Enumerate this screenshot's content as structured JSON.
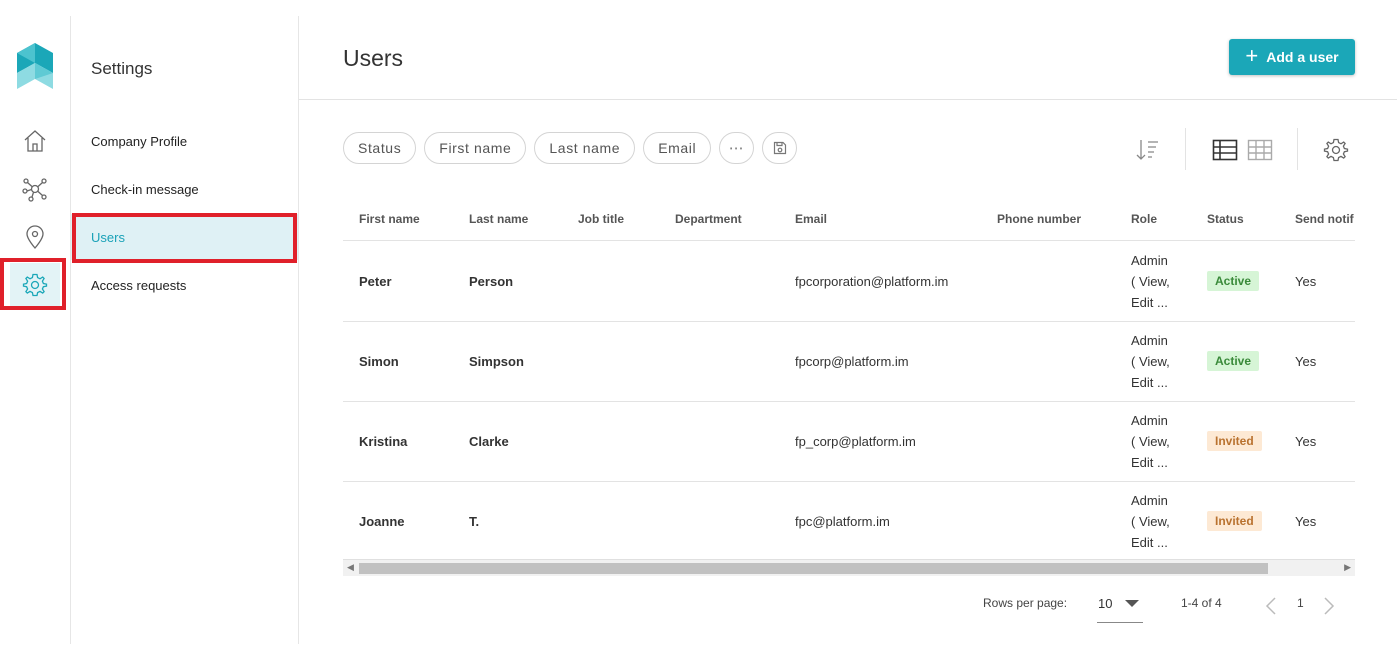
{
  "brand": {
    "accent": "#1ba7b8",
    "highlight": "#e0202a"
  },
  "rail": {
    "items": [
      {
        "icon": "home-icon"
      },
      {
        "icon": "network-icon"
      },
      {
        "icon": "location-pin-icon"
      },
      {
        "icon": "gear-icon",
        "active": true
      }
    ]
  },
  "settings_nav": {
    "title": "Settings",
    "items": [
      {
        "label": "Company Profile"
      },
      {
        "label": "Check-in message"
      },
      {
        "label": "Users",
        "active": true
      },
      {
        "label": "Access requests"
      }
    ]
  },
  "page": {
    "title": "Users",
    "add_button": "Add a user"
  },
  "filters": {
    "chips": [
      "Status",
      "First name",
      "Last name",
      "Email"
    ],
    "more": "⋯"
  },
  "table": {
    "columns": [
      "First name",
      "Last name",
      "Job title",
      "Department",
      "Email",
      "Phone number",
      "Role",
      "Status",
      "Send notif"
    ],
    "rows": [
      {
        "first": "Peter",
        "last": "Person",
        "email": "fpcorporation@platform.im",
        "role": "Admin ( View, Edit ...",
        "status": "Active",
        "notif": "Yes"
      },
      {
        "first": "Simon",
        "last": "Simpson",
        "email": "fpcorp@platform.im",
        "role": "Admin ( View, Edit ...",
        "status": "Active",
        "notif": "Yes"
      },
      {
        "first": "Kristina",
        "last": "Clarke",
        "email": "fp_corp@platform.im",
        "role": "Admin ( View, Edit ...",
        "status": "Invited",
        "notif": "Yes"
      },
      {
        "first": "Joanne",
        "last": "T.",
        "email": "fpc@platform.im",
        "role": "Admin ( View, Edit ...",
        "status": "Invited",
        "notif": "Yes"
      }
    ],
    "status_colors": {
      "Active": {
        "bg": "#d6f5d6",
        "fg": "#3a8a3a"
      },
      "Invited": {
        "bg": "#fde9d4",
        "fg": "#b9722f"
      }
    }
  },
  "pagination": {
    "rows_per_page_label": "Rows per page:",
    "rows_per_page": "10",
    "range": "1-4 of 4",
    "page": "1"
  }
}
